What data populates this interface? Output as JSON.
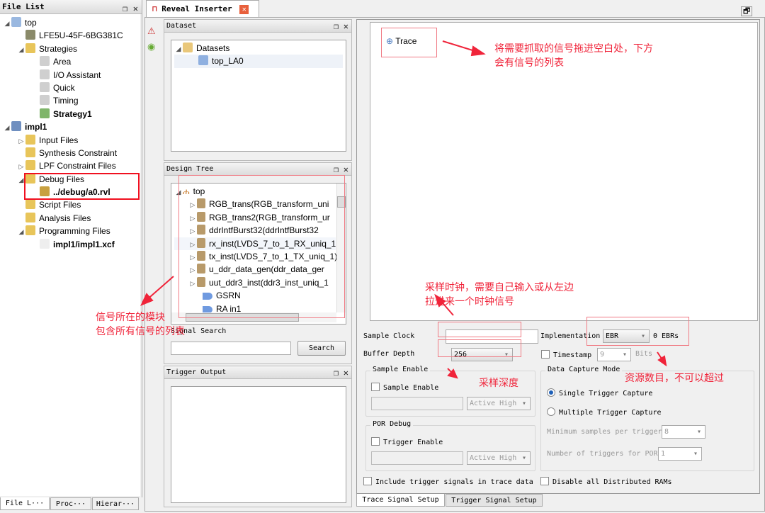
{
  "file_list": {
    "title": "File List",
    "items": [
      {
        "label": "top",
        "level": 0,
        "icon": "project-icon"
      },
      {
        "label": "LFE5U-45F-6BG381C",
        "level": 1,
        "icon": "device-icon"
      },
      {
        "label": "Strategies",
        "level": 1,
        "icon": "folder-icon"
      },
      {
        "label": "Area",
        "level": 2,
        "icon": "strategy-icon"
      },
      {
        "label": "I/O Assistant",
        "level": 2,
        "icon": "strategy-icon"
      },
      {
        "label": "Quick",
        "level": 2,
        "icon": "strategy-icon"
      },
      {
        "label": "Timing",
        "level": 2,
        "icon": "strategy-icon"
      },
      {
        "label": "Strategy1",
        "level": 2,
        "icon": "active-strategy-icon",
        "bold": true
      },
      {
        "label": "impl1",
        "level": 0,
        "icon": "implementation-icon",
        "bold": true
      },
      {
        "label": "Input Files",
        "level": 1,
        "icon": "folder-icon"
      },
      {
        "label": "Synthesis Constraint",
        "level": 1,
        "icon": "folder-icon"
      },
      {
        "label": "LPF Constraint Files",
        "level": 1,
        "icon": "folder-icon"
      },
      {
        "label": "Debug Files",
        "level": 1,
        "icon": "folder-icon"
      },
      {
        "label": "../debug/a0.rvl",
        "level": 2,
        "icon": "reveal-file-icon",
        "bold": true
      },
      {
        "label": "Script Files",
        "level": 1,
        "icon": "folder-icon"
      },
      {
        "label": "Analysis Files",
        "level": 1,
        "icon": "folder-icon"
      },
      {
        "label": "Programming Files",
        "level": 1,
        "icon": "folder-icon"
      },
      {
        "label": "impl1/impl1.xcf",
        "level": 2,
        "icon": "xcf-file-icon",
        "bold": true
      }
    ],
    "bottom_tabs": [
      "File L···",
      "Proc···",
      "Hierar···"
    ]
  },
  "editor_tab": {
    "label": "Reveal Inserter"
  },
  "dataset": {
    "title": "Dataset",
    "root": "Datasets",
    "child": "top_LA0"
  },
  "design_tree": {
    "title": "Design Tree",
    "root": "top",
    "items": [
      "RGB_trans(RGB_transform_uni",
      "RGB_trans2(RGB_transform_ur",
      "ddrIntfBurst32(ddrIntfBurst32",
      "rx_inst(LVDS_7_to_1_RX_uniq_1",
      "tx_inst(LVDS_7_to_1_TX_uniq_1)",
      "u_ddr_data_gen(ddr_data_ger",
      "uut_ddr3_inst(ddr3_inst_uniq_1"
    ],
    "ports": [
      "GSRN",
      "RA in1"
    ]
  },
  "signal_search": {
    "label": "Signal Search",
    "button": "Search",
    "value": ""
  },
  "trigger_output": {
    "title": "Trigger Output"
  },
  "trace": {
    "label": "Trace"
  },
  "settings": {
    "sample_clock_label": "Sample Clock",
    "sample_clock_value": "",
    "implementation_label": "Implementation",
    "implementation_value": "EBR",
    "ebr_count": "0 EBRs",
    "buffer_depth_label": "Buffer Depth",
    "buffer_depth_value": "256",
    "timestamp_label": "Timestamp",
    "timestamp_value": "9",
    "bits_label": "Bits",
    "sample_enable_group": "Sample Enable",
    "sample_enable_label": "Sample Enable",
    "active_high": "Active High",
    "por_group": "POR Debug",
    "trigger_enable_label": "Trigger Enable",
    "capture_group": "Data Capture Mode",
    "single": "Single Trigger Capture",
    "multiple": "Multiple Trigger Capture",
    "min_samples_label": "Minimum samples per trigger",
    "min_samples_value": "8",
    "num_triggers_label": "Number of triggers for POR",
    "num_triggers_value": "1",
    "include_trigger": "Include trigger signals in trace data",
    "disable_rams": "Disable all Distributed RAMs"
  },
  "bottom_tabs": [
    "Trace Signal Setup",
    "Trigger Signal Setup"
  ],
  "annotations": {
    "drag": "将需要抓取的信号拖进空白处，下方\n会有信号的列表",
    "module": "信号所在的模块\n包含所有信号的列表",
    "clock": "采样时钟，需要自己输入或从左边\n拉进来一个时钟信号",
    "depth": "采样深度",
    "resource": "资源数目，不可以超过"
  },
  "colors": {
    "annotation": "#f0243a",
    "selection": "#1d5fb7"
  }
}
